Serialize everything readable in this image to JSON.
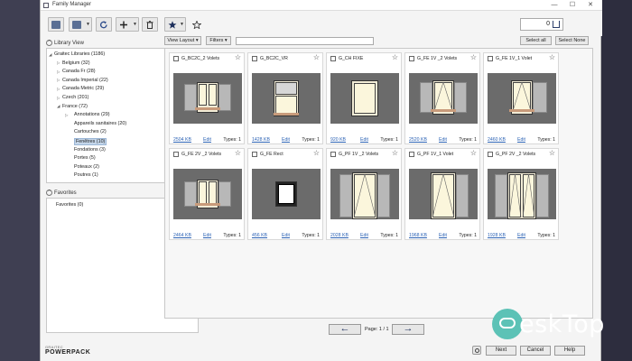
{
  "window": {
    "title": "Family Manager",
    "minimize": "—",
    "maximize": "☐",
    "close": "✕"
  },
  "cart": {
    "count": "0"
  },
  "library_view": {
    "header": "Library View",
    "tree": [
      {
        "label": "Graitec Libraries (1186)",
        "level": 0,
        "arrow": "open"
      },
      {
        "label": "Belgium (32)",
        "level": 1,
        "arrow": "closed"
      },
      {
        "label": "Canada Fr (28)",
        "level": 1,
        "arrow": "closed"
      },
      {
        "label": "Canada Imperial (22)",
        "level": 1,
        "arrow": "closed"
      },
      {
        "label": "Canada Metric (29)",
        "level": 1,
        "arrow": "closed"
      },
      {
        "label": "Czech (201)",
        "level": 1,
        "arrow": "closed"
      },
      {
        "label": "France (72)",
        "level": 1,
        "arrow": "open"
      },
      {
        "label": "Annotations (29)",
        "level": 2,
        "arrow": "closed"
      },
      {
        "label": "Appareils sanitaires (20)",
        "level": 2,
        "arrow": ""
      },
      {
        "label": "Cartouches (2)",
        "level": 2,
        "arrow": ""
      },
      {
        "label": "Fenêtres (10)",
        "level": 2,
        "arrow": "",
        "selected": true
      },
      {
        "label": "Fondations (3)",
        "level": 2,
        "arrow": ""
      },
      {
        "label": "Portes (5)",
        "level": 2,
        "arrow": ""
      },
      {
        "label": "Poteaux (2)",
        "level": 2,
        "arrow": ""
      },
      {
        "label": "Poutres (1)",
        "level": 2,
        "arrow": ""
      }
    ]
  },
  "favorites": {
    "header": "Favorites",
    "item": "Favorites (0)"
  },
  "filterbar": {
    "view_layout": "View Layout",
    "filters": "Filters",
    "search_value": "",
    "select_all": "Select all",
    "select_none": "Select None"
  },
  "families": [
    {
      "name": "G_BC2C_2 Volets",
      "size": "2504 KB",
      "edit": "Edit",
      "types": "Types: 1",
      "kind": "shutters2"
    },
    {
      "name": "G_BC2C_VR",
      "size": "1428 KB",
      "edit": "Edit",
      "types": "Types: 1",
      "kind": "rollup"
    },
    {
      "name": "G_CH FIXE",
      "size": "920 KB",
      "edit": "Edit",
      "types": "Types: 1",
      "kind": "fixed"
    },
    {
      "name": "G_FE 1V _2 Volets",
      "size": "2520 KB",
      "edit": "Edit",
      "types": "Types: 1",
      "kind": "fe1v2"
    },
    {
      "name": "G_FE 1V_1 Volet",
      "size": "2460 KB",
      "edit": "Edit",
      "types": "Types: 1",
      "kind": "fe1v1"
    },
    {
      "name": "G_FE 2V _2 Volets",
      "size": "2464 KB",
      "edit": "Edit",
      "types": "Types: 1",
      "kind": "fe2v"
    },
    {
      "name": "G_FE Rect",
      "size": "456 KB",
      "edit": "Edit",
      "types": "Types: 1",
      "kind": "rect"
    },
    {
      "name": "G_PF 1V _2 Volets",
      "size": "2028 KB",
      "edit": "Edit",
      "types": "Types: 1",
      "kind": "pf1v2"
    },
    {
      "name": "G_PF 1V_1 Volet",
      "size": "1968 KB",
      "edit": "Edit",
      "types": "Types: 1",
      "kind": "pf1v1"
    },
    {
      "name": "G_PF 2V _2 Volets",
      "size": "1928 KB",
      "edit": "Edit",
      "types": "Types: 1",
      "kind": "pf2v"
    }
  ],
  "pager": {
    "prev": "←",
    "next": "→",
    "label": "Page: 1 / 1"
  },
  "footer": {
    "brand_small": "GRAITEC",
    "brand_big": "POWERPACK",
    "next": "Next",
    "cancel": "Cancel",
    "help": "Help"
  },
  "watermark": {
    "text": "eskTop"
  }
}
